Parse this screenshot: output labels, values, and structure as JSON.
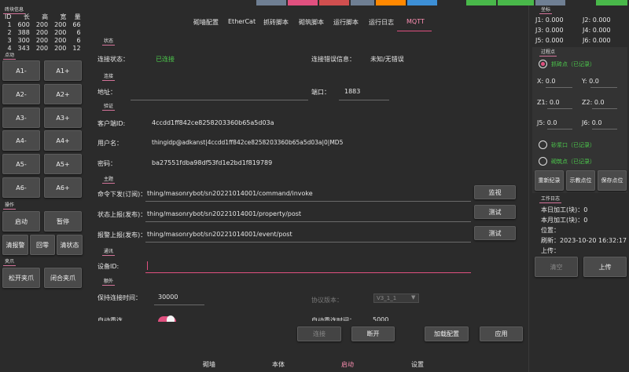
{
  "top_caps": [
    {
      "color": "#6f7f93"
    },
    {
      "color": "#e0507f"
    },
    {
      "color": "#d04f4f"
    },
    {
      "color": "#6f7f93"
    },
    {
      "color": "#ff8800"
    },
    {
      "color": "#3d8fd6"
    },
    {
      "color": "#49b84a"
    },
    {
      "color": "#49b84a"
    },
    {
      "color": "#6f7f93"
    },
    {
      "color": "#49b84a"
    }
  ],
  "left": {
    "info_title": "砖块信息",
    "columns": [
      "ID",
      "长",
      "高",
      "宽",
      "量"
    ],
    "rows": [
      [
        "1",
        "600",
        "200",
        "200",
        "66"
      ],
      [
        "2",
        "388",
        "200",
        "200",
        "6"
      ],
      [
        "3",
        "300",
        "200",
        "200",
        "6"
      ],
      [
        "4",
        "343",
        "200",
        "200",
        "12"
      ]
    ],
    "jog_title": "点动",
    "jog_buttons": [
      "A1-",
      "A1+",
      "A2-",
      "A2+",
      "A3-",
      "A3+",
      "A4-",
      "A4+",
      "A5-",
      "A5+",
      "A6-",
      "A6+"
    ],
    "op_title": "操作",
    "op_start": "启动",
    "op_pause": "暂停",
    "op_clear_count": "清报警",
    "op_home": "回零",
    "op_clear_status": "清状态",
    "clamp_title": "夹爪",
    "clamp_open": "松开夹爪",
    "clamp_close": "闭合夹爪"
  },
  "tabs": [
    "砌墙配置",
    "EtherCat",
    "抓砖脚本",
    "砌筑脚本",
    "运行脚本",
    "运行日志",
    "MQTT"
  ],
  "active_tab": "MQTT",
  "mqtt": {
    "status_group": "状态",
    "conn_status_label": "连接状态：",
    "conn_status_value": "已连接",
    "conn_error_label": "连接错误信息：",
    "conn_error_value": "未知/无错误",
    "link_group": "连接",
    "address_label": "地址：",
    "address_value": "",
    "port_label": "端口：",
    "port_value": "1883",
    "auth_group": "验证",
    "client_id_label": "客户端ID:",
    "client_id_value": "4ccdd1ff842ce8258203360b65a5d03a",
    "username_label": "用户名：",
    "username_value": "thingidp@adkanst|4ccdd1ff842ce8258203360b65a5d03a|0|MD5",
    "password_label": "密码：",
    "password_value": "ba27551fdba98df53fd1e2bd1f819789",
    "topic_group": "主题",
    "cmd_label": "命令下发(订阅)：",
    "cmd_value": "thing/masonrybot/sn20221014001/command/invoke",
    "cmd_btn": "监视",
    "state_label": "状态上报(发布)：",
    "state_value": "thing/masonrybot/sn20221014001/property/post",
    "state_btn": "测试",
    "alarm_label": "报警上报(发布)：",
    "alarm_value": "thing/masonrybot/sn20221014001/event/post",
    "alarm_btn": "测试",
    "comm_group": "通讯",
    "device_id_label": "设备ID:",
    "device_id_value": "",
    "adv_group": "额外",
    "keepalive_label": "保持连接时间：",
    "keepalive_value": "30000",
    "proto_label": "协议版本：",
    "proto_value": "V3_1_1",
    "auto_reconnect_label": "自动重连",
    "auto_reconnect_interval_label": "自动重连时间：",
    "auto_reconnect_interval_value": "5000",
    "btn_connect": "连接",
    "btn_disconnect": "断开",
    "btn_load": "加载配置",
    "btn_apply": "应用"
  },
  "bottom_tabs": [
    "砌墙",
    "本体",
    "启动",
    "设置"
  ],
  "bottom_active": "启动",
  "right": {
    "coord_title": "坐标",
    "coords": [
      {
        "label": "J1:",
        "value": "0.000"
      },
      {
        "label": "J2:",
        "value": "0.000"
      },
      {
        "label": "J3:",
        "value": "0.000"
      },
      {
        "label": "J4:",
        "value": "0.000"
      },
      {
        "label": "J5:",
        "value": "0.000"
      },
      {
        "label": "J6:",
        "value": "0.000"
      }
    ],
    "points_title": "过程点",
    "grab_point": "抓砖点（已记录）",
    "xyz": [
      {
        "label": "X:",
        "value": "0.0"
      },
      {
        "label": "Y:",
        "value": "0.0"
      },
      {
        "label": "Z1:",
        "value": "0.0"
      },
      {
        "label": "Z2:",
        "value": "0.0"
      },
      {
        "label": "J5:",
        "value": "0.0"
      },
      {
        "label": "J6:",
        "value": "0.0"
      }
    ],
    "mortar_point": "砂浆口（已记录）",
    "build_point": "砌筑点（已记录）",
    "btn_rerecord": "重新纪录",
    "btn_teach": "示教点位",
    "btn_save": "保存点位",
    "log_title": "工作日志",
    "today_label": "本日加工(块)：",
    "today_value": "0",
    "month_label": "本月加工(块)：",
    "month_value": "0",
    "position_label": "位置：",
    "position_value": "",
    "refresh_label": "刷新：",
    "refresh_value": "2023-10-20 16:32:17",
    "upload_label": "上传：",
    "upload_value": "",
    "btn_clear": "清空",
    "btn_upload": "上传"
  }
}
